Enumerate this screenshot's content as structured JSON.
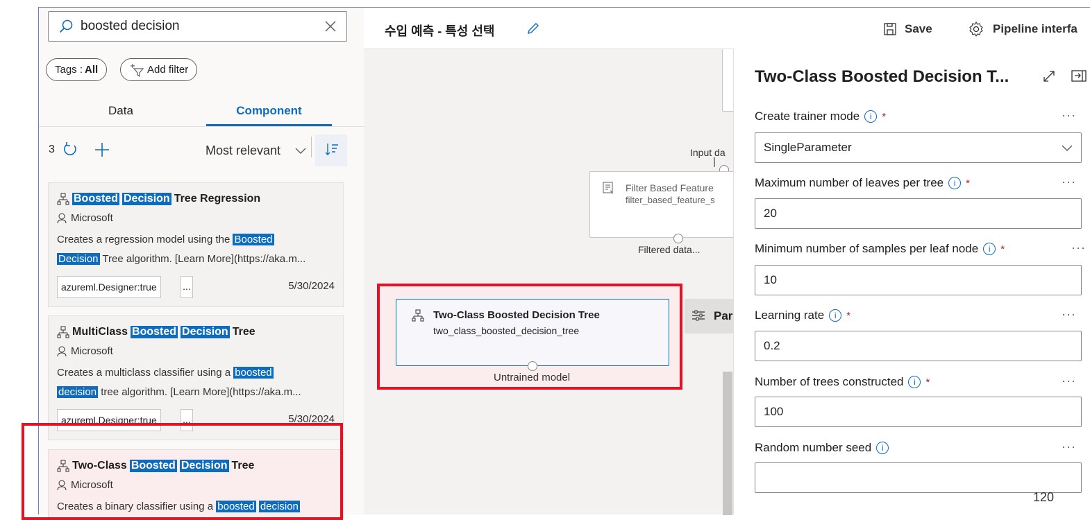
{
  "search": {
    "value": "boosted decision"
  },
  "filters": {
    "tags_prefix": "Tags :",
    "tags_value": "All",
    "add_filter": "Add filter"
  },
  "tabs": {
    "data": "Data",
    "component": "Component"
  },
  "results": {
    "count": "3",
    "sort": "Most relevant"
  },
  "cards": [
    {
      "title_parts": [
        "Boosted",
        "Decision",
        "Tree Regression"
      ],
      "publisher": "Microsoft",
      "desc_line1_a": "Creates a regression model using the ",
      "desc_line1_hl": "Boosted",
      "desc_line2_hl": "Decision",
      "desc_line2_b": " Tree algorithm. [Learn More](https://aka.m...",
      "tag": "azureml.Designer:true",
      "more": "...",
      "date": "5/30/2024"
    },
    {
      "title_parts": [
        "MultiClass",
        "Boosted",
        "Decision",
        "Tree"
      ],
      "publisher": "Microsoft",
      "desc_line1_a": "Creates a multiclass classifier using a ",
      "desc_line1_hl": "boosted",
      "desc_line2_hl": "decision",
      "desc_line2_b": " tree algorithm. [Learn More](https://aka.m...",
      "tag": "azureml.Designer:true",
      "more": "...",
      "date": "5/30/2024"
    },
    {
      "title_parts": [
        "Two-Class",
        "Boosted",
        "Decision",
        "Tree"
      ],
      "publisher": "Microsoft",
      "desc_line1_a": "Creates a binary classifier using a ",
      "desc_line1_hl": "boosted",
      "desc_line1_hl2": "decision"
    }
  ],
  "pipeline": {
    "title": "수입 예측 - 특성 선택",
    "save": "Save",
    "interface": "Pipeline interfa"
  },
  "canvas": {
    "input_label": "Input da",
    "filter_node_title": "Filter Based Feature",
    "filter_node_sub": "filter_based_feature_s",
    "filtered_label": "Filtered data...",
    "tree_node_title": "Two-Class Boosted Decision Tree",
    "tree_node_sub": "two_class_boosted_decision_tree",
    "untrained_label": "Untrained model",
    "params_label": "Par"
  },
  "props": {
    "title": "Two-Class Boosted Decision T...",
    "fields": [
      {
        "label": "Create trainer mode",
        "required": "*",
        "value": "SingleParameter"
      },
      {
        "label": "Maximum number of leaves per tree",
        "required": "*",
        "value": "20"
      },
      {
        "label": "Minimum number of samples per leaf node",
        "required": "*",
        "value": "10"
      },
      {
        "label": "Learning rate",
        "required": "*",
        "value": "0.2"
      },
      {
        "label": "Number of trees constructed",
        "required": "*",
        "value": "100"
      },
      {
        "label": "Random number seed",
        "required": "",
        "value": ""
      }
    ]
  },
  "page_number": "120",
  "colors": {
    "accent": "#0f6cbd",
    "highlight_box": "#e81123",
    "highlight_fill": "#fbeded"
  }
}
